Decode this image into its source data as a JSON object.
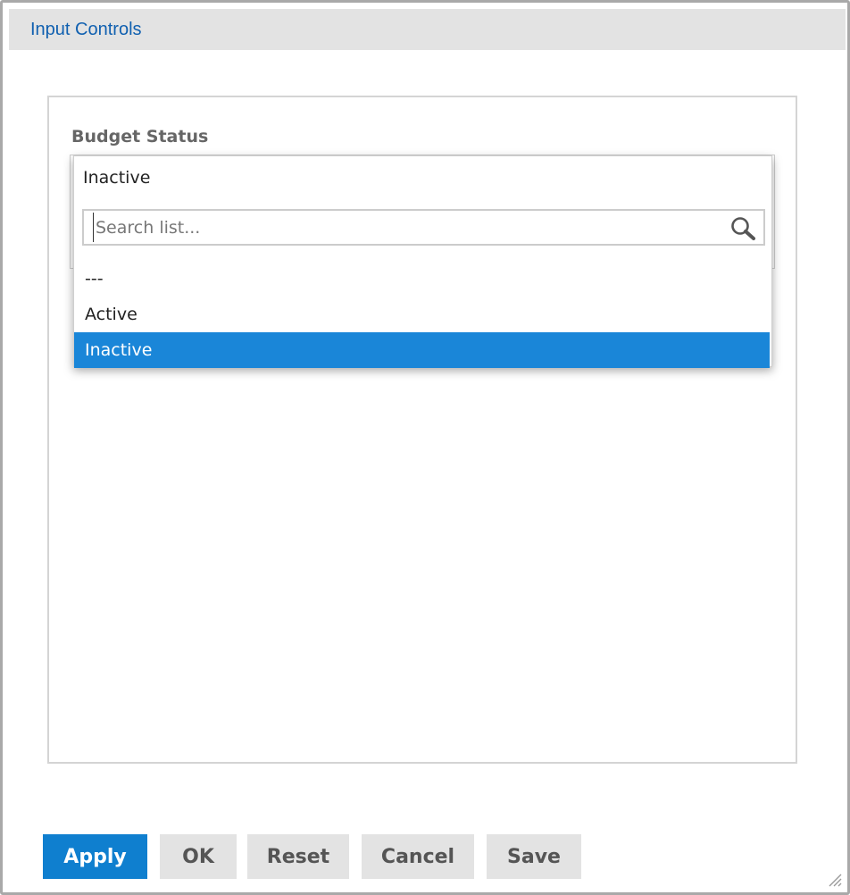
{
  "dialog": {
    "title": "Input Controls"
  },
  "control": {
    "label": "Budget Status",
    "selected_value": "Inactive",
    "search": {
      "placeholder": "Search list...",
      "value": ""
    },
    "options": [
      {
        "label": "---",
        "selected": false
      },
      {
        "label": "Active",
        "selected": false
      },
      {
        "label": "Inactive",
        "selected": true
      }
    ]
  },
  "buttons": {
    "apply": "Apply",
    "ok": "OK",
    "reset": "Reset",
    "cancel": "Cancel",
    "save": "Save"
  },
  "icons": {
    "search": "search-icon",
    "resize": "resize-grip-icon"
  },
  "colors": {
    "accent": "#0f7fcf",
    "selection": "#1a86d8",
    "title": "#1060b0",
    "header_bg": "#e3e3e3"
  }
}
